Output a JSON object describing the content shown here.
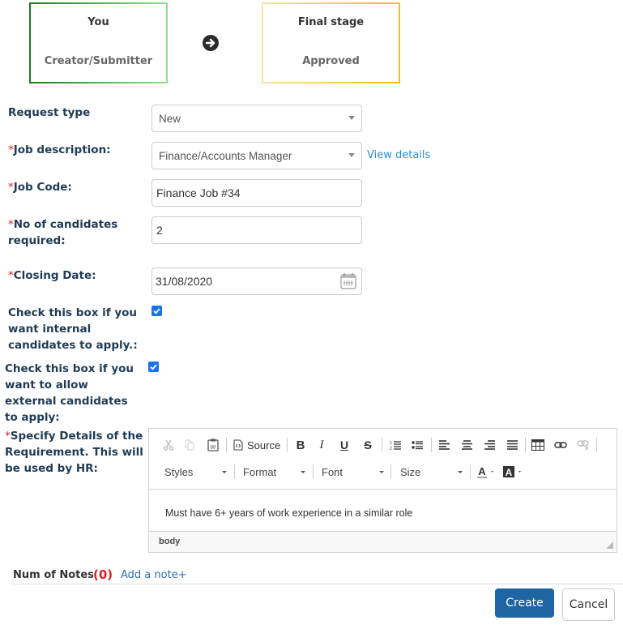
{
  "workflow": {
    "stages": [
      {
        "title": "You",
        "role": "Creator/Submitter"
      },
      {
        "title": "Final stage",
        "role": "Approved"
      }
    ],
    "arrow_icon": "arrow-circle-right-icon"
  },
  "form": {
    "required_marker": "*",
    "request_type": {
      "label": "Request type",
      "value": "New"
    },
    "job_description": {
      "label": "Job description:",
      "value": "Finance/Accounts Manager",
      "link": "View details"
    },
    "job_code": {
      "label": "Job Code:",
      "value": "Finance Job #34"
    },
    "candidates": {
      "label": "No of candidates required:",
      "value": "2"
    },
    "closing_date": {
      "label": "Closing Date:",
      "value": "31/08/2020",
      "icon": "calendar-icon"
    },
    "internal_candidates": {
      "label": "Check this box if you want internal candidates to apply.:",
      "checked": true
    },
    "external_candidates": {
      "label": "Check this box if you want to allow external candidates to apply:",
      "checked": true
    },
    "details": {
      "label": "Specify Details of the Requirement. This will be used by HR:",
      "content": "Must have 6+ years of work experience in a similar role",
      "status_path": "body"
    }
  },
  "editor_toolbar": {
    "row1": [
      "cut",
      "copy",
      "paste-from-word",
      "Source",
      "bold",
      "italic",
      "underline",
      "strikethrough",
      "numbered-list",
      "bulleted-list",
      "align-left",
      "align-center",
      "align-right",
      "justify",
      "table",
      "link",
      "unlink"
    ],
    "source_label": "Source",
    "styles_label": "Styles",
    "format_label": "Format",
    "font_label": "Font",
    "size_label": "Size"
  },
  "notes": {
    "label": "Num of Notes",
    "count": "(0)",
    "add_link": "Add a note+"
  },
  "actions": {
    "create": "Create",
    "cancel": "Cancel"
  },
  "colors": {
    "primary": "#1f64a3",
    "required": "#e02020",
    "link": "#2b8ccf",
    "label": "#1f3b57",
    "checkbox": "#1a73e8"
  }
}
